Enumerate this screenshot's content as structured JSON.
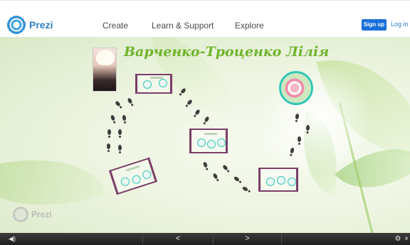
{
  "header": {
    "logo_text": "Prezi",
    "nav": {
      "create": "Create",
      "learn_support": "Learn & Support",
      "explore": "Explore"
    },
    "signup_label": "Sign up",
    "login_label": "Log in"
  },
  "presentation": {
    "title": "Варченко-Троценко Лілія",
    "watermark_text": "Prezi"
  },
  "toolbar": {
    "sound_icon": "speaker-icon",
    "prev_label": "<",
    "next_label": ">",
    "settings_icon": "gear-icon",
    "more_icon": "close-icon"
  },
  "colors": {
    "brand_blue": "#2f80c9",
    "signup_bg": "#1a6fd9",
    "title_green": "#6fb42c",
    "frame_purple": "#7b3e67",
    "accent_teal": "#33c7b8",
    "toolbar_bg": "#2a2a2a"
  }
}
